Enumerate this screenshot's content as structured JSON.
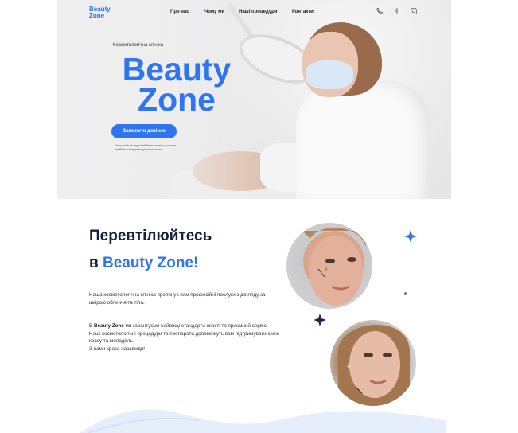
{
  "nav": {
    "logo_line1": "Beauty",
    "logo_line2": "Zone",
    "links": [
      "Про нас",
      "Чому ми",
      "Наші процедури",
      "Контакти"
    ],
    "icons": [
      "phone-icon",
      "viber-icon",
      "instagram-icon"
    ]
  },
  "hero": {
    "kicker": "Косметологічна клініка",
    "title_line1": "Beauty",
    "title_line2": "Zone",
    "cta_label": "Замовити дзвінок",
    "note": "Замовляй не нервовий безкоштовно у нашим найбільш вигідним мультиплексом"
  },
  "intro": {
    "heading_line1": "Перевтілюйтесь",
    "heading_prefix": "в ",
    "heading_accent": "Beauty Zone!",
    "p1": "Наша косметологічна клініка пропонує вам професійні послуги з догляду за шкірою обличчя та тіла.",
    "p2_prefix": "В ",
    "p2_bold": "Beauty Zone",
    "p2_rest": " ми гарантуємо найвищі стандарти якості та приємний сервіс. Наші косметологічні процедури та препарати допоможуть вам підтримувати свою красу та молодість.",
    "p2_last": "З нами краса назавжди!"
  },
  "colors": {
    "accent": "#2f74f0",
    "heading": "#14213d",
    "star_blue": "#2f74f0",
    "star_dark": "#1c2b4a"
  }
}
